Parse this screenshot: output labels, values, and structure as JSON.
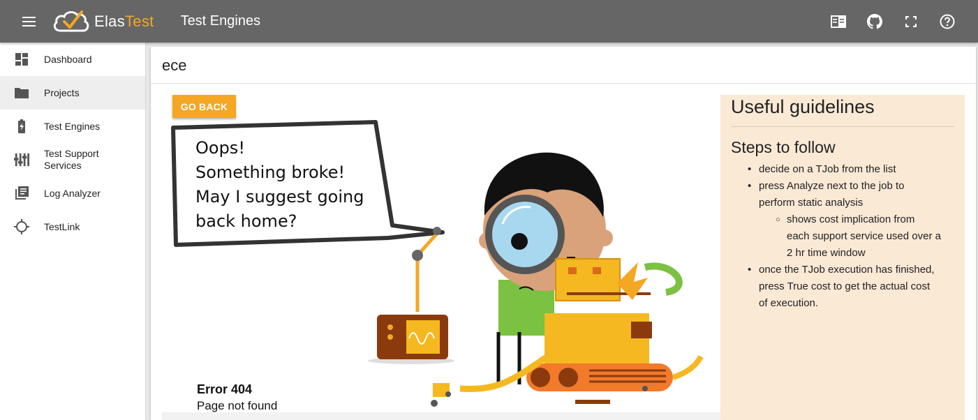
{
  "app": {
    "brand_part1": "Elas",
    "brand_part2": "Test",
    "page_heading": "Test Engines"
  },
  "topbar_icons": [
    "toggle-panel-icon",
    "github-icon",
    "fullscreen-icon",
    "help-icon"
  ],
  "sidebar": {
    "items": [
      {
        "label": "Dashboard",
        "icon": "dashboard-icon",
        "active": false
      },
      {
        "label": "Projects",
        "icon": "folder-icon",
        "active": true
      },
      {
        "label": "Test Engines",
        "icon": "battery-charging-icon",
        "active": false
      },
      {
        "label": "Test Support Services",
        "line1": "Test Support",
        "line2": "Services",
        "icon": "tune-sliders-icon",
        "active": false
      },
      {
        "label": "Log Analyzer",
        "icon": "library-books-icon",
        "active": false
      },
      {
        "label": "TestLink",
        "icon": "crosshair-icon",
        "active": false
      }
    ]
  },
  "card": {
    "title": "ece"
  },
  "error_page": {
    "go_back_label": "GO BACK",
    "bubble_lines": [
      "Oops!",
      "Something broke!",
      "May I suggest going",
      "back home?"
    ],
    "error_code": "Error 404",
    "error_message": "Page not found"
  },
  "guidelines": {
    "title": "Useful guidelines",
    "subtitle": "Steps to follow",
    "steps": [
      {
        "text": "decide on a TJob from the list"
      },
      {
        "text": "press Analyze next to the job to perform static analysis",
        "line1": "press Analyze next to the job to",
        "line2": "perform static analysis",
        "substeps": [
          {
            "text": "shows cost implication from each support service used over a 2 hr time window",
            "line1": "shows cost implication from",
            "line2": "each support service used over a",
            "line3": "2 hr time window"
          }
        ]
      },
      {
        "text": "once the TJob execution has finished, press True cost to get the actual cost of execution.",
        "line1": "once the TJob execution has finished,",
        "line2": "press True cost to get the actual cost",
        "line3": "of execution."
      }
    ]
  },
  "colors": {
    "topbar": "#666666",
    "accent": "#f5a623",
    "guide_panel": "#fae9d5",
    "sidebar_active": "#eeeeee"
  }
}
